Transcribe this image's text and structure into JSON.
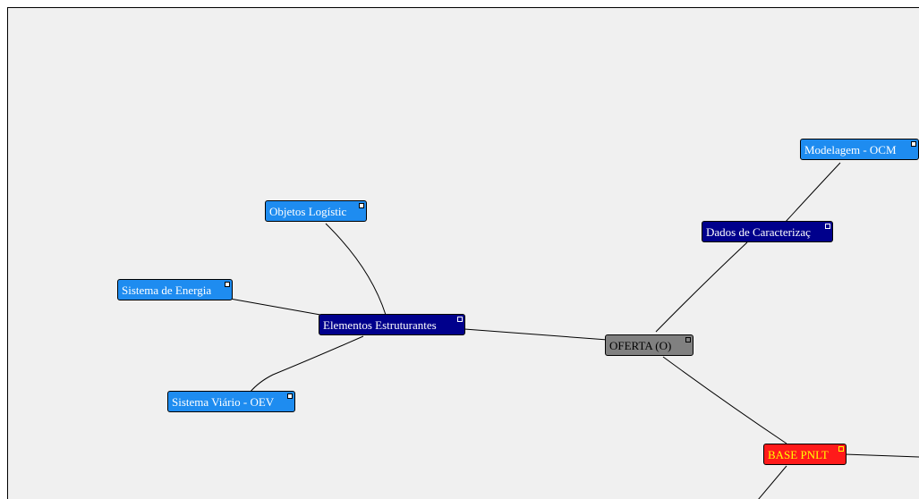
{
  "nodes": {
    "oferta": "OFERTA (O)",
    "elementos": "Elementos Estruturantes",
    "objetos": "Objetos Logístic",
    "energia": "Sistema de Energia",
    "viario": "Sistema Viário - OEV",
    "dados": "Dados de Caracterizaç",
    "modelagem": "Modelagem - OCM",
    "base": "BASE PNLT"
  },
  "colors": {
    "canvas": "#f0f0f0",
    "light_node": "#1e8cf0",
    "dark_node": "#00008c",
    "root_node": "#808080",
    "highlight_node": "#ff1a1a",
    "highlight_text": "#ffff00"
  }
}
